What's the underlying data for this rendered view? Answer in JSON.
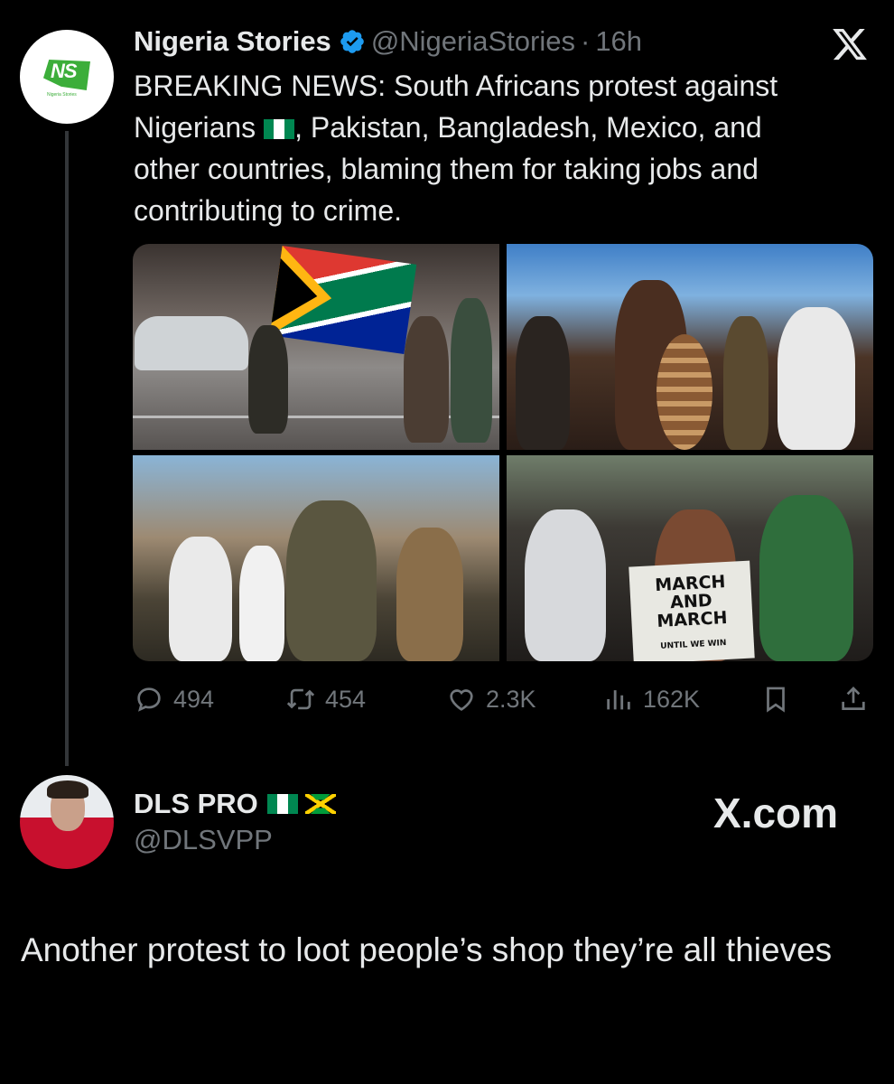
{
  "quoted_tweet": {
    "author_name": "Nigeria Stories",
    "handle": "@NigeriaStories",
    "separator": "·",
    "time": "16h",
    "avatar_logo_text": "NS",
    "avatar_logo_subtext": "Nigeria Stories",
    "text_line1": "BREAKING NEWS: South Africans protest against",
    "text_line2a": "Nigerians ",
    "text_line2b": ", Pakistan, Bangladesh, Mexico, and",
    "text_line3": "other countries, blaming them for taking jobs and",
    "text_line4": "contributing to crime.",
    "media_signs": {
      "sign_line1": "MARCH",
      "sign_line2": "AND",
      "sign_line3": "MARCH",
      "sign_line4": "UNTIL WE WIN"
    },
    "stats": {
      "replies": "494",
      "reposts": "454",
      "likes": "2.3K",
      "views": "162K"
    }
  },
  "reply": {
    "author_name": "DLS PRO",
    "handle": "@DLSVPP",
    "watermark": "X.com",
    "text": "Another protest to loot people’s shop they’re all thieves"
  },
  "colors": {
    "background": "#000000",
    "primary_text": "#e7e9ea",
    "secondary_text": "#71767b",
    "verified_blue": "#1d9bf0",
    "brand_green": "#3cae3a"
  },
  "icons": [
    "close-x-icon",
    "verified-badge-icon",
    "reply-icon",
    "repost-icon",
    "like-icon",
    "views-icon",
    "bookmark-icon",
    "share-icon"
  ]
}
